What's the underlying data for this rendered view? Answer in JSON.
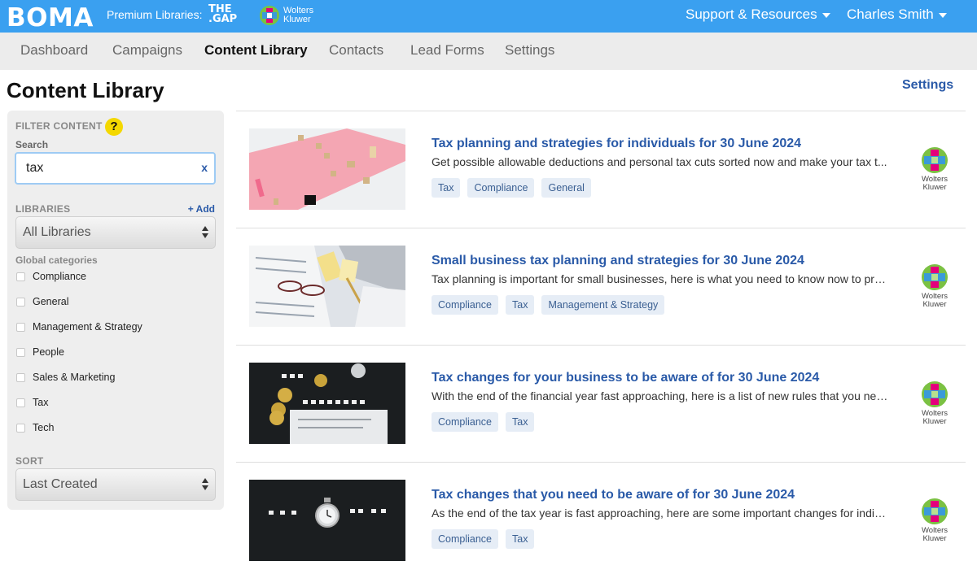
{
  "header": {
    "brand": "BOMA",
    "premium_label": "Premium Libraries:",
    "premium_libraries": [
      {
        "name_line1": "THE",
        "name_line2": ".GAP"
      },
      {
        "name_line1": "Wolters",
        "name_line2": "Kluwer"
      }
    ],
    "support_label": "Support & Resources",
    "user_name": "Charles Smith"
  },
  "nav": {
    "tabs": [
      "Dashboard",
      "Campaigns",
      "Content Library",
      "Contacts",
      "Lead Forms",
      "Settings"
    ],
    "active": "Content Library"
  },
  "page": {
    "title": "Content Library",
    "settings_link": "Settings"
  },
  "filter": {
    "heading": "FILTER CONTENT",
    "help": "?",
    "search_label": "Search",
    "search_value": "tax",
    "clear": "x",
    "libraries_heading": "LIBRARIES",
    "add_label": "+ Add",
    "libraries_selected": "All Libraries",
    "categories_heading": "Global categories",
    "categories": [
      "Compliance",
      "General",
      "Management & Strategy",
      "People",
      "Sales & Marketing",
      "Tax",
      "Tech"
    ],
    "sort_heading": "SORT",
    "sort_selected": "Last Created"
  },
  "items": [
    {
      "title": "Tax planning and strategies for individuals for 30 June 2024",
      "desc": "Get possible allowable deductions and personal tax cuts sorted now and make your tax t...",
      "tags": [
        "Tax",
        "Compliance",
        "General"
      ],
      "source_line1": "Wolters",
      "source_line2": "Kluwer"
    },
    {
      "title": "Small business tax planning and strategies for 30 June 2024",
      "desc": "Tax planning is important for small businesses, here is what you need to know now to pre...",
      "tags": [
        "Compliance",
        "Tax",
        "Management & Strategy"
      ],
      "source_line1": "Wolters",
      "source_line2": "Kluwer"
    },
    {
      "title": "Tax changes for your business to be aware of for 30 June 2024",
      "desc": "With the end of the financial year fast approaching, here is a list of new rules that you nee...",
      "tags": [
        "Compliance",
        "Tax"
      ],
      "source_line1": "Wolters",
      "source_line2": "Kluwer"
    },
    {
      "title": "Tax changes that you need to be aware of for 30 June 2024",
      "desc": "As the end of the tax year is fast approaching, here are some important changes for indivi...",
      "tags": [
        "Compliance",
        "Tax"
      ],
      "source_line1": "Wolters",
      "source_line2": "Kluwer"
    }
  ],
  "colors": {
    "topbar": "#3aa0f0",
    "link": "#2a5aa8",
    "tag_bg": "#e6edf6",
    "help_icon": "#f4d800"
  }
}
